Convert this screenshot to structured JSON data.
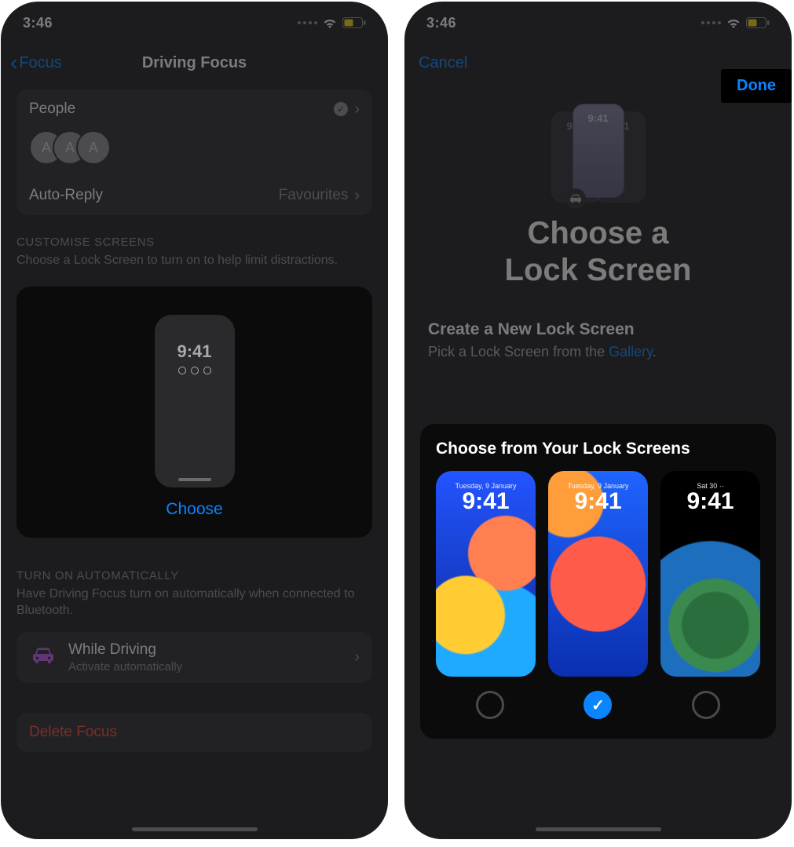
{
  "status": {
    "time": "3:46"
  },
  "left": {
    "nav": {
      "back": "Focus",
      "title": "Driving Focus"
    },
    "people": {
      "label": "People",
      "avatars": [
        "A",
        "A",
        "A"
      ],
      "autoreply_label": "Auto-Reply",
      "autoreply_value": "Favourites"
    },
    "customise": {
      "header": "CUSTOMISE SCREENS",
      "desc": "Choose a Lock Screen to turn on to help limit distractions.",
      "preview_time": "9:41",
      "choose": "Choose"
    },
    "auto": {
      "header": "TURN ON AUTOMATICALLY",
      "desc": "Have Driving Focus turn on automatically when connected to Bluetooth.",
      "row_title": "While Driving",
      "row_sub": "Activate automatically"
    },
    "delete": "Delete Focus"
  },
  "right": {
    "cancel": "Cancel",
    "done": "Done",
    "preview_time": "9:41",
    "title_l1": "Choose a",
    "title_l2": "Lock Screen",
    "create_h": "Create a New Lock Screen",
    "create_p_pre": "Pick a Lock Screen from the ",
    "create_p_link": "Gallery",
    "chooser_h": "Choose from Your Lock Screens",
    "cards": [
      {
        "date": "Tuesday, 9 January",
        "time": "9:41",
        "selected": false
      },
      {
        "date": "Tuesday, 9 January",
        "time": "9:41",
        "selected": true
      },
      {
        "date": "Sat 30 ··",
        "time": "9:41",
        "selected": false
      }
    ]
  }
}
